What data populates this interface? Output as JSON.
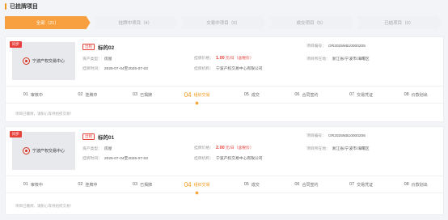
{
  "section": {
    "title": "已挂牌项目"
  },
  "tabs": [
    {
      "label": "全部（21）",
      "active": true
    },
    {
      "label": "挂牌中项目（4）",
      "active": false
    },
    {
      "label": "交易中项目（0）",
      "active": false
    },
    {
      "label": "成交项目（5）",
      "active": false
    },
    {
      "label": "已结项目（0）",
      "active": false
    }
  ],
  "cards": [
    {
      "ribbon": "同步",
      "logo_text": "宁波产权交易中心",
      "tag": "出租",
      "name": "标的02",
      "project_no_label": "项目编号：",
      "project_no": "GR2025NB10000205",
      "type_label": "资产类型：",
      "type": "房屋",
      "price_label": "挂牌价格：",
      "price": "1.00",
      "price_unit": "元/日（含税价）",
      "location_label": "项目所在地：",
      "location": "浙江省/宁波市/海曙区",
      "time_label": "挂牌时间：",
      "time": "2025-07-04至2025-07-03",
      "org_label": "挂牌机构：",
      "org": "宁波产权交易中心有限公司",
      "note": "项目已撤牌，请耐心等待组织交易！"
    },
    {
      "ribbon": "同步",
      "logo_text": "宁波产权交易中心",
      "tag": "出租",
      "name": "标的01",
      "project_no_label": "项目编号：",
      "project_no": "GR2025NB10000206",
      "type_label": "资产类型：",
      "type": "房屋",
      "price_label": "挂牌价格：",
      "price": "2.00",
      "price_unit": "元/日（含税价）",
      "location_label": "项目所在地：",
      "location": "浙江省/宁波市/海曙区",
      "time_label": "挂牌时间：",
      "time": "2025-07-04至2025-07-03",
      "org_label": "挂牌机构：",
      "org": "宁波产权交易中心有限公司",
      "note": "项目已撤牌，请耐心等待组织交易！"
    }
  ],
  "steps": [
    {
      "num": "01",
      "label": "审核中"
    },
    {
      "num": "02",
      "label": "挂牌中"
    },
    {
      "num": "03",
      "label": "已揭牌"
    },
    {
      "num": "04",
      "label": "组织交易",
      "active": true
    },
    {
      "num": "05",
      "label": "成交"
    },
    {
      "num": "06",
      "label": "合同签约"
    },
    {
      "num": "07",
      "label": "交易凭证"
    },
    {
      "num": "08",
      "label": "价款划出"
    }
  ],
  "colors": {
    "accent": "#f39a21",
    "tab_active": "#f8a03f",
    "danger": "#e8413c"
  }
}
